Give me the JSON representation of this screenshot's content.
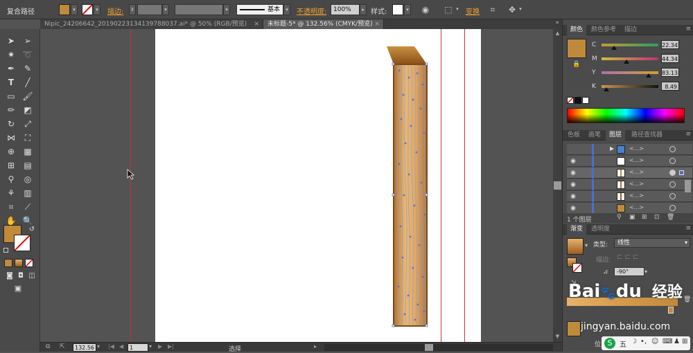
{
  "control_bar": {
    "selection_label": "复合路径",
    "stroke_label": "描边:",
    "line_style": "基本",
    "opacity_label": "不透明度:",
    "opacity_value": "100%",
    "style_label": "样式:",
    "transform_label": "变换"
  },
  "tabs": [
    {
      "label": "Nipic_24206642_20190223134139788037.ai* @ 50% (RGB/预览)",
      "active": false
    },
    {
      "label": "未标题-5* @ 132.56% (CMYK/预览)",
      "active": true
    }
  ],
  "status_bar": {
    "zoom": "132.56",
    "page": "1",
    "mode": "选择"
  },
  "color_panel": {
    "tabs": [
      "颜色",
      "颜色参考",
      "描边"
    ],
    "channels": [
      {
        "name": "C",
        "value": "22.34",
        "fraction": 0.2234
      },
      {
        "name": "M",
        "value": "44.34",
        "fraction": 0.4434
      },
      {
        "name": "Y",
        "value": "83.13",
        "fraction": 0.8313
      },
      {
        "name": "K",
        "value": "8.49",
        "fraction": 0.0849
      }
    ]
  },
  "layers_panel": {
    "tabs": [
      "色板",
      "画笔",
      "图层",
      "路径查找器"
    ],
    "rows": [
      {
        "name": "<...>"
      },
      {
        "name": "<...>"
      },
      {
        "name": "<...>"
      },
      {
        "name": "<...>"
      },
      {
        "name": "<...>"
      },
      {
        "name": "<...>"
      }
    ],
    "count_label": "1 个图层"
  },
  "gradient_panel": {
    "tabs": [
      "渐变",
      "透明度"
    ],
    "type_label": "类型:",
    "type_value": "线性",
    "stroke_label": "描边:",
    "angle_value": "-90°",
    "position_label": "位置"
  },
  "watermark": {
    "brand": "Bai",
    "brand2": "du",
    "sub": "经验",
    "url": "jingyan.baidu.com"
  },
  "colors": {
    "fill": "#c08a3c",
    "wood_light": "#e8b26a",
    "wood_dark": "#9a5c22",
    "guide": "#c8323a"
  }
}
